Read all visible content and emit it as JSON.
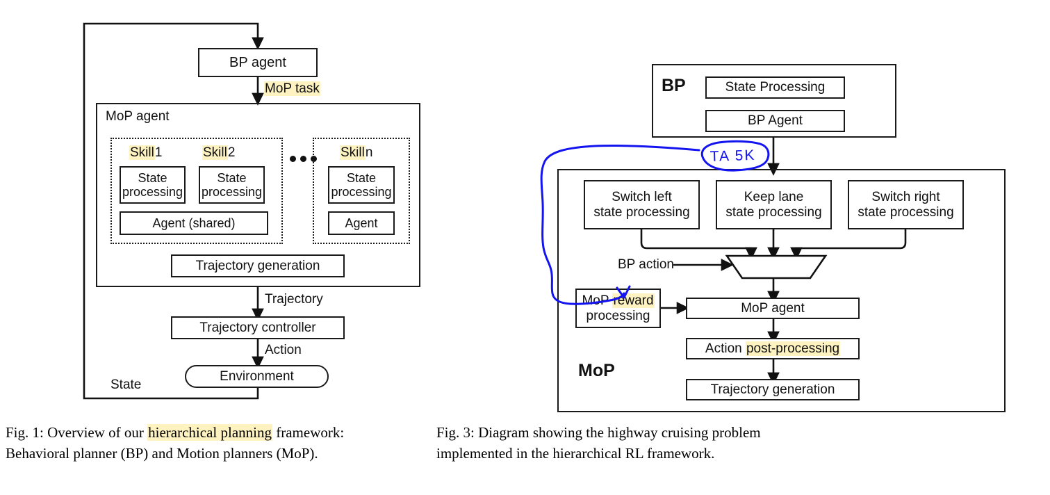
{
  "figure1": {
    "id": "Fig. 1",
    "mop_agent_title": "MoP agent",
    "bp_agent_box": "BP agent",
    "edge_mop_task": "MoP task",
    "edge_trajectory": "Trajectory",
    "edge_action": "Action",
    "edge_state": "State",
    "skills": [
      {
        "title_highlight": "Skill",
        "title_index": "1",
        "state_processing": "State\nprocessing"
      },
      {
        "title_highlight": "Skill",
        "title_index": "2",
        "state_processing": "State\nprocessing"
      },
      {
        "title_highlight": "Skill",
        "title_index": "n",
        "state_processing": "State\nprocessing"
      }
    ],
    "agent_shared": "Agent  (shared)",
    "agent_n": "Agent",
    "ellipsis": "•••",
    "trajectory_generation": "Trajectory generation",
    "trajectory_controller": "Trajectory controller",
    "environment": "Environment",
    "caption_prefix": "Fig. 1: Overview of our ",
    "caption_highlight": "hierarchical planning",
    "caption_suffix": " framework:",
    "caption_line2": "Behavioral planner (BP) and Motion planners (MoP)."
  },
  "figure3": {
    "id": "Fig. 3",
    "bp_tag": "BP",
    "mop_tag": "MoP",
    "bp_state_processing": "State Processing",
    "bp_agent": "BP Agent",
    "switch_left": "Switch left\nstate processing",
    "keep_lane": "Keep lane\nstate processing",
    "switch_right": "Switch right\nstate processing",
    "bp_action_label": "BP action",
    "mop_reward_prefix": "MoP ",
    "mop_reward_highlight": "reward",
    "mop_reward_suffix": "processing",
    "mop_agent": "MoP agent",
    "action_post_prefix": "Action ",
    "action_post_highlight": "post-processing",
    "trajectory_generation": "Trajectory generation",
    "annotation": {
      "text": "TA 5K",
      "color": "#1414f0",
      "kind": "handwritten-ink"
    },
    "caption_line1": "Fig. 3: Diagram showing the highway cruising problem",
    "caption_line2": "implemented in the hierarchical RL framework."
  },
  "colors": {
    "ink": "#111111",
    "highlight": "#fdf2c0",
    "annotation_blue": "#1414f0",
    "page_background": "#ffffff"
  }
}
